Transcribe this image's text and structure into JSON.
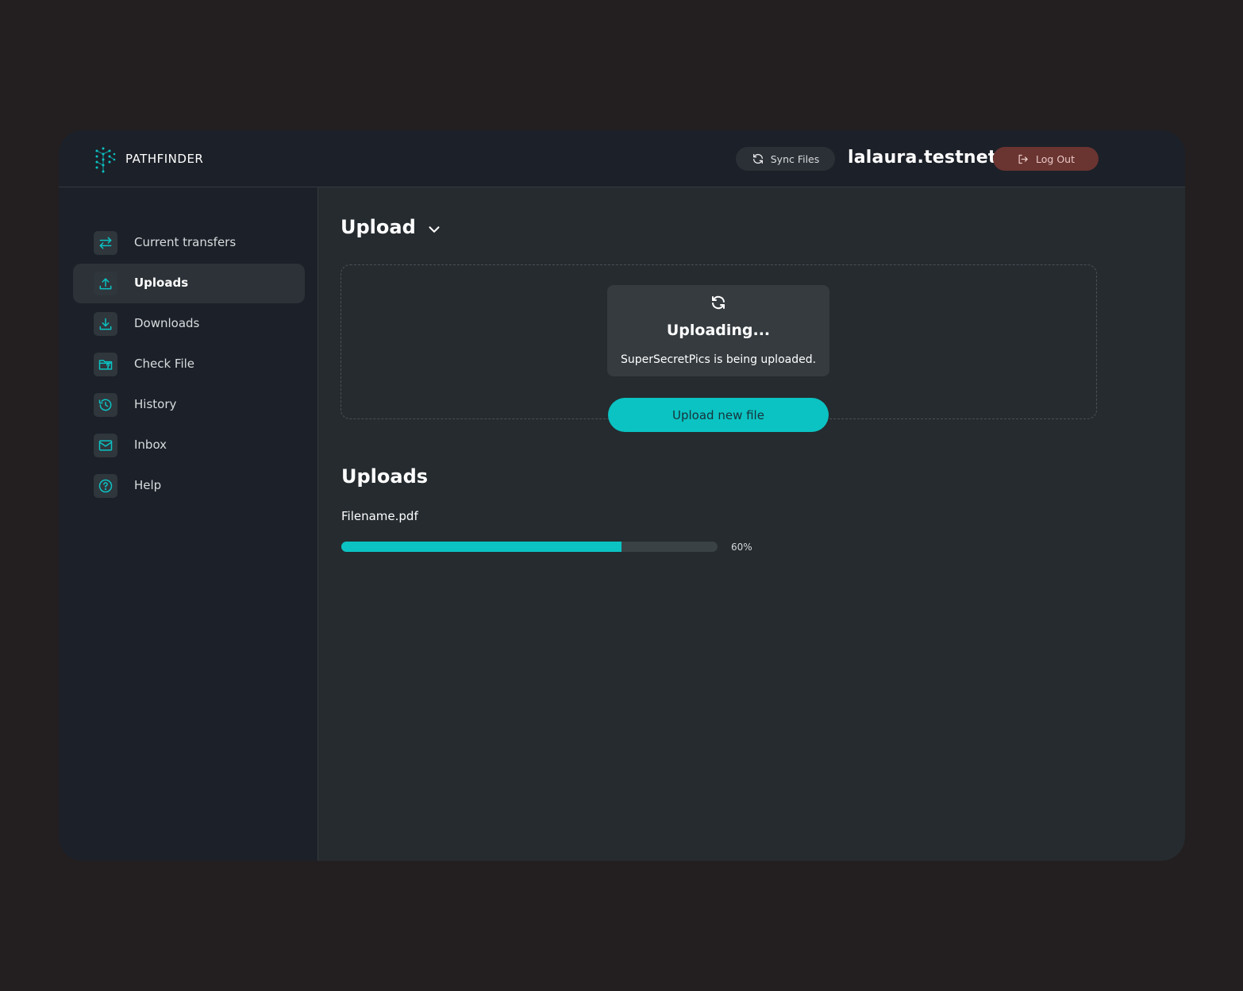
{
  "app": {
    "name": "PATHFINDER",
    "accent_color": "#0bc3c3"
  },
  "header": {
    "sync_label": "Sync Files",
    "username": "lalaura.testnet",
    "logout_label": "Log Out"
  },
  "sidebar": {
    "items": [
      {
        "label": "Current transfers",
        "icon": "transfer-arrows-icon",
        "active": false
      },
      {
        "label": "Uploads",
        "icon": "upload-icon",
        "active": true
      },
      {
        "label": "Downloads",
        "icon": "download-icon",
        "active": false
      },
      {
        "label": "Check File",
        "icon": "folder-question-icon",
        "active": false
      },
      {
        "label": "History",
        "icon": "history-icon",
        "active": false
      },
      {
        "label": "Inbox",
        "icon": "mail-icon",
        "active": false
      },
      {
        "label": "Help",
        "icon": "help-icon",
        "active": false
      }
    ]
  },
  "main": {
    "section_title": "Upload",
    "status": {
      "title": "Uploading...",
      "message": "SuperSecretPics is being uploaded."
    },
    "upload_button_label": "Upload new file",
    "uploads_title": "Uploads",
    "uploads": [
      {
        "filename": "Filename.pdf",
        "progress_label": "60%",
        "progress": 0.745
      }
    ]
  }
}
